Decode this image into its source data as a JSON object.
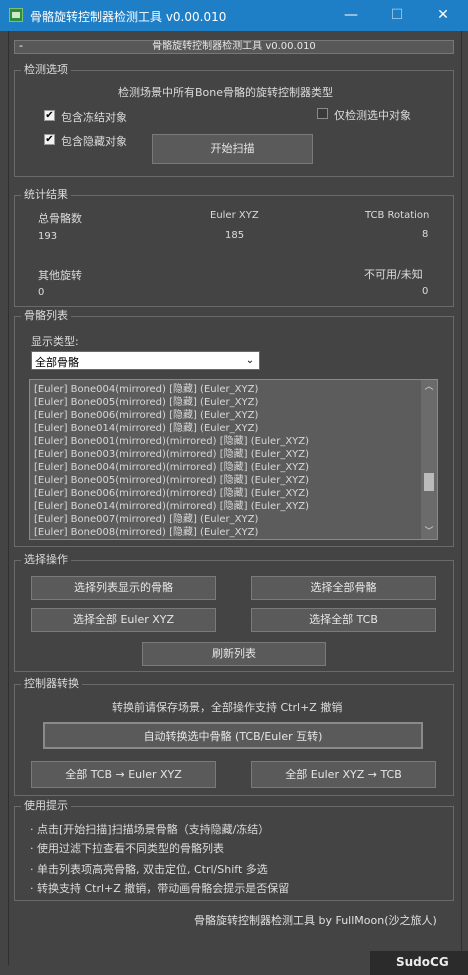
{
  "window": {
    "title": "骨骼旋转控制器检测工具 v0.00.010",
    "minimize": "—",
    "maximize": "☐",
    "close": "✕",
    "icon": "app-icon"
  },
  "rollout": {
    "toggle": "-",
    "title": "骨骼旋转控制器检测工具 v0.00.010"
  },
  "detect": {
    "legend": "检测选项",
    "description": "检测场景中所有Bone骨骼的旋转控制器类型",
    "include_frozen": "包含冻结对象",
    "include_frozen_checked": true,
    "include_hidden": "包含隐藏对象",
    "include_hidden_checked": true,
    "selected_only": "仅检测选中对象",
    "selected_only_checked": false,
    "scan_button": "开始扫描"
  },
  "stats": {
    "legend": "统计结果",
    "total_label": "总骨骼数",
    "total_value": "193",
    "euler_label": "Euler XYZ",
    "euler_value": "185",
    "tcb_label": "TCB Rotation",
    "tcb_value": "8",
    "other_label": "其他旋转",
    "other_value": "0",
    "unavailable_label": "不可用/未知",
    "unavailable_value": "0"
  },
  "bones": {
    "legend": "骨骼列表",
    "filter_label": "显示类型:",
    "filter_value": "全部骨骼",
    "items": [
      "[Euler] Bone004(mirrored) [隐藏]  (Euler_XYZ)",
      "[Euler] Bone005(mirrored) [隐藏]  (Euler_XYZ)",
      "[Euler] Bone006(mirrored) [隐藏]  (Euler_XYZ)",
      "[Euler] Bone014(mirrored) [隐藏]  (Euler_XYZ)",
      "[Euler] Bone001(mirrored)(mirrored) [隐藏]  (Euler_XYZ)",
      "[Euler] Bone003(mirrored)(mirrored) [隐藏]  (Euler_XYZ)",
      "[Euler] Bone004(mirrored)(mirrored) [隐藏]  (Euler_XYZ)",
      "[Euler] Bone005(mirrored)(mirrored) [隐藏]  (Euler_XYZ)",
      "[Euler] Bone006(mirrored)(mirrored) [隐藏]  (Euler_XYZ)",
      "[Euler] Bone014(mirrored)(mirrored) [隐藏]  (Euler_XYZ)",
      "[Euler] Bone007(mirrored) [隐藏]  (Euler_XYZ)",
      "[Euler] Bone008(mirrored) [隐藏]  (Euler_XYZ)"
    ],
    "scrollbar_up": "︿",
    "scrollbar_down": "﹀"
  },
  "select_ops": {
    "legend": "选择操作",
    "select_listed": "选择列表显示的骨骼",
    "select_all": "选择全部骨骼",
    "select_all_euler": "选择全部 Euler XYZ",
    "select_all_tcb": "选择全部 TCB",
    "refresh": "刷新列表"
  },
  "convert": {
    "legend": "控制器转换",
    "note": "转换前请保存场景，全部操作支持 Ctrl+Z 撤销",
    "auto_convert": "自动转换选中骨骼 (TCB/Euler 互转)",
    "tcb_to_euler": "全部 TCB → Euler XYZ",
    "euler_to_tcb": "全部 Euler XYZ → TCB"
  },
  "tips": {
    "legend": "使用提示",
    "items": [
      "· 点击[开始扫描]扫描场景骨骼（支持隐藏/冻结）",
      "· 使用过滤下拉查看不同类型的骨骼列表",
      "· 单击列表项高亮骨骼, 双击定位, Ctrl/Shift 多选",
      "· 转换支持 Ctrl+Z 撤销，带动画骨骼会提示是否保留"
    ]
  },
  "footer": "骨骼旋转控制器检测工具 by FullMoon(沙之旅人)",
  "watermark": "SudoCG",
  "colors": {
    "titlebar": "#1f7fc6",
    "panel": "#444444",
    "list_bg": "#5c5c5c",
    "button": "#5a5a5a"
  }
}
